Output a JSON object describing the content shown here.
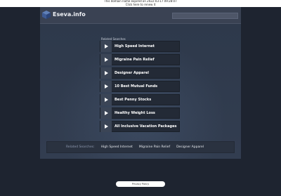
{
  "topbar": {
    "expired_notice": "This domain name expired on 2022-03-17 09:28:07",
    "renew_link": "Click here to renew it"
  },
  "header": {
    "site_name": "Eseva.info",
    "search_placeholder": ""
  },
  "related": {
    "title": "Related Searches",
    "items": [
      "High Speed Internet",
      "Migraine Pain Relief",
      "Designer Apparel",
      "10 Best Mutual Funds",
      "Best Penny Stocks",
      "Healthy Weight Loss",
      "All Inclusive Vacation Packages"
    ]
  },
  "bottom": {
    "label": "Related Searches:",
    "links": [
      "High Speed Internet",
      "Migraine Pain Relief",
      "Designer Apparel"
    ]
  },
  "footer": {
    "privacy": "Privacy Policy"
  },
  "colors": {
    "background": "#1e2430",
    "panel": "#3a4558",
    "link_bg": "#232a36"
  },
  "icons": {
    "logo": "cube-logo-icon",
    "arrow": "play-arrow-icon"
  }
}
